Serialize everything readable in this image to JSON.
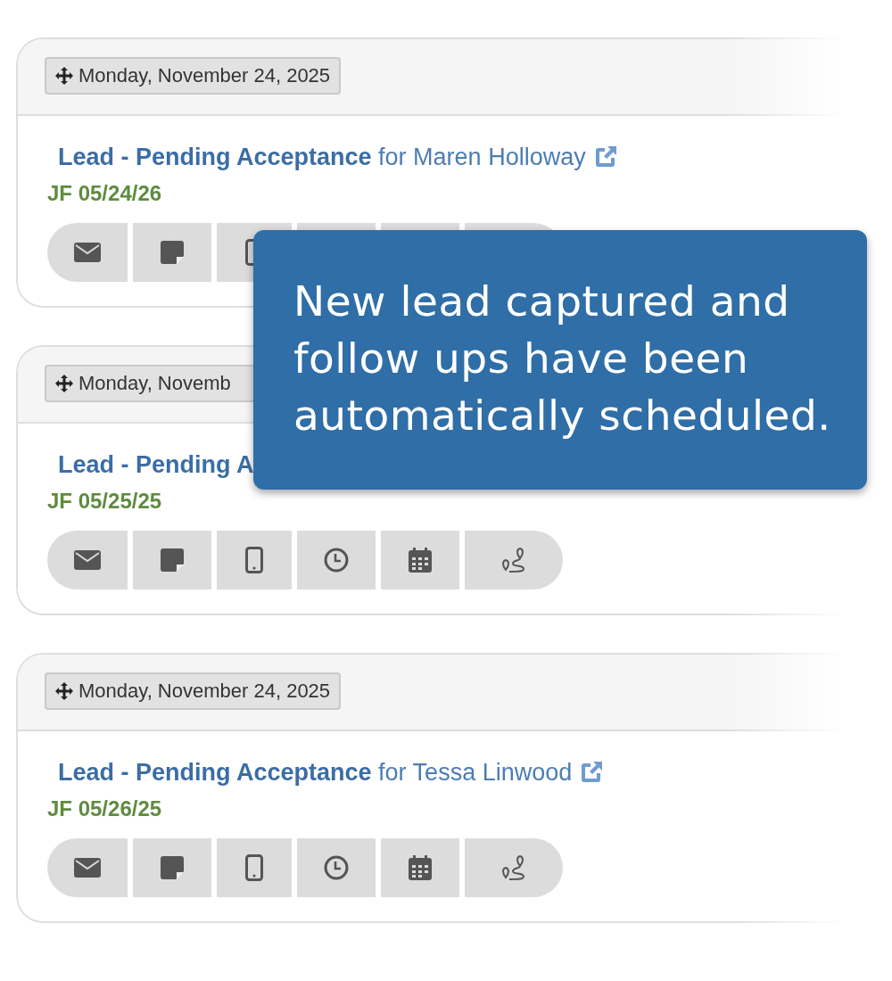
{
  "entries": [
    {
      "date": "Monday, November 24, 2025",
      "lead": "**Lead - Pending Acceptance** for Maren Holloway",
      "external_link": true,
      "jf": "JF 05/24/26",
      "actions": [
        {
          "kind": "email"
        },
        {
          "kind": "note"
        },
        {
          "kind": "phone_edge"
        },
        {
          "kind": "covered"
        },
        {
          "kind": "covered"
        },
        {
          "kind": "covered"
        }
      ]
    },
    {
      "date": "Monday, Novemb",
      "lead": "**Lead - Pending A**",
      "jf": "JF 05/25/25",
      "actions": [
        {
          "kind": "email"
        },
        {
          "kind": "note"
        },
        {
          "kind": "phone"
        },
        {
          "kind": "clock"
        },
        {
          "kind": "calendar"
        },
        {
          "kind": "route"
        }
      ]
    },
    {
      "date": "Monday, November 24, 2025",
      "lead": "**Lead - Pending Acceptance** for Tessa Linwood",
      "external_link": true,
      "jf": "JF 05/26/25",
      "actions": [
        {
          "kind": "email"
        },
        {
          "kind": "note"
        },
        {
          "kind": "phone"
        },
        {
          "kind": "clock"
        },
        {
          "kind": "calendar"
        },
        {
          "kind": "route"
        }
      ]
    }
  ],
  "callout": {
    "text": "New lead captured and follow ups have been automatically scheduled."
  }
}
